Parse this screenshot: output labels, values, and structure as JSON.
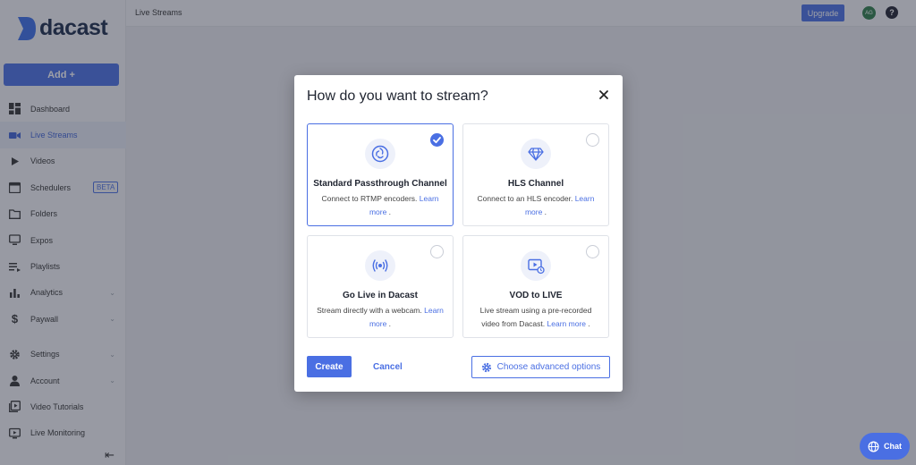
{
  "app": {
    "logo_text": "dacast"
  },
  "sidebar": {
    "add_label": "Add +",
    "items": [
      {
        "label": "Dashboard",
        "icon": "dashboard-icon"
      },
      {
        "label": "Live Streams",
        "icon": "video-camera-icon",
        "active": true
      },
      {
        "label": "Videos",
        "icon": "play-icon"
      },
      {
        "label": "Schedulers",
        "icon": "calendar-icon",
        "badge": "BETA"
      },
      {
        "label": "Folders",
        "icon": "folder-icon"
      },
      {
        "label": "Expos",
        "icon": "monitor-icon"
      },
      {
        "label": "Playlists",
        "icon": "playlist-icon"
      },
      {
        "label": "Analytics",
        "icon": "bar-chart-icon"
      },
      {
        "label": "Paywall",
        "icon": "dollar-icon"
      },
      {
        "label": "Settings",
        "icon": "gear-icon"
      },
      {
        "label": "Account",
        "icon": "person-icon"
      },
      {
        "label": "Video Tutorials",
        "icon": "video-tutorial-icon"
      },
      {
        "label": "Live Monitoring",
        "icon": "live-monitor-icon"
      }
    ]
  },
  "topbar": {
    "breadcrumb": "Live Streams",
    "upgrade_label": "Upgrade",
    "avatar_initials": "AG",
    "help_label": "?"
  },
  "modal": {
    "title": "How do you want to stream?",
    "options": [
      {
        "title": "Standard Passthrough Channel",
        "desc": "Connect to RTMP encoders.",
        "link": "Learn more",
        "suffix": " .",
        "selected": true,
        "icon": "obs-icon"
      },
      {
        "title": "HLS Channel",
        "desc": "Connect to an HLS encoder.",
        "link": "Learn more",
        "suffix": " .",
        "selected": false,
        "icon": "diamond-icon"
      },
      {
        "title": "Go Live in Dacast",
        "desc": "Stream directly with a webcam.",
        "link": "Learn more",
        "suffix": " .",
        "selected": false,
        "icon": "broadcast-icon"
      },
      {
        "title": "VOD to LIVE",
        "desc": "Live stream using a pre-recorded video from Dacast.",
        "link": "Learn more",
        "suffix": " .",
        "selected": false,
        "icon": "vod-clock-icon"
      }
    ],
    "create_label": "Create",
    "cancel_label": "Cancel",
    "advanced_label": "Choose advanced options"
  },
  "chat": {
    "label": "Chat"
  },
  "colors": {
    "accent": "#4a6fe3",
    "overlay": "rgba(40,45,60,0.45)",
    "text": "#1f2430"
  }
}
